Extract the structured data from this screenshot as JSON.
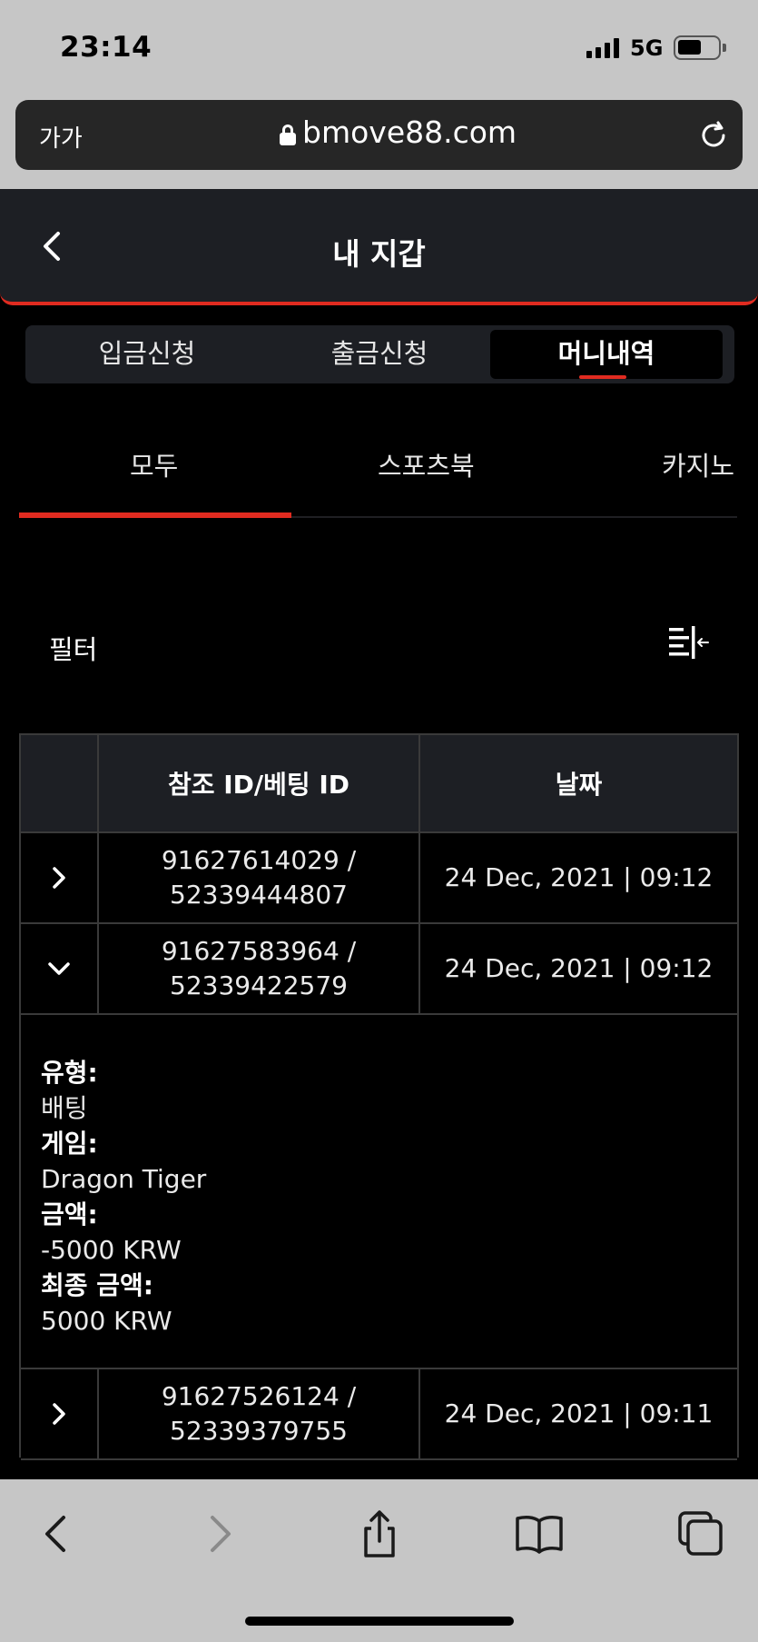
{
  "status_bar": {
    "time": "23:14",
    "network": "5G",
    "icons": [
      "signal-icon",
      "battery-icon"
    ]
  },
  "browser": {
    "text_size_button": "가가",
    "url": "bmove88.com",
    "icons": [
      "lock-icon",
      "reload-icon"
    ]
  },
  "header": {
    "title": "내 지갑",
    "back_icon": "chevron-left-icon",
    "accent_color": "#e02b20"
  },
  "wallet_tabs": [
    {
      "label": "입금신청",
      "active": false
    },
    {
      "label": "출금신청",
      "active": false
    },
    {
      "label": "머니내역",
      "active": true
    }
  ],
  "category_tabs": [
    {
      "label": "모두",
      "active": true
    },
    {
      "label": "스포츠북",
      "active": false
    },
    {
      "label": "카지노",
      "active": false
    }
  ],
  "filter": {
    "label": "필터",
    "icon": "filter-collapse-icon"
  },
  "table": {
    "columns": [
      "",
      "참조 ID/베팅 ID",
      "날짜"
    ],
    "rows": [
      {
        "expanded": false,
        "ref_id": "91627614029 /",
        "bet_id": "52339444807",
        "date": "24 Dec, 2021 | 09:12"
      },
      {
        "expanded": true,
        "ref_id": "91627583964 /",
        "bet_id": "52339422579",
        "date": "24 Dec, 2021 | 09:12"
      },
      {
        "expanded": false,
        "ref_id": "91627526124 /",
        "bet_id": "52339379755",
        "date": "24 Dec, 2021 | 09:11"
      }
    ],
    "details": {
      "type_label": "유형:",
      "type_value": "배팅",
      "game_label": "게임:",
      "game_value": "Dragon Tiger",
      "amount_label": "금액:",
      "amount_value": "-5000 KRW",
      "final_label": "최종 금액:",
      "final_value": "5000 KRW"
    }
  },
  "bottom_toolbar": {
    "icons": [
      "back-icon",
      "forward-icon",
      "share-icon",
      "bookmarks-icon",
      "tabs-icon"
    ]
  }
}
